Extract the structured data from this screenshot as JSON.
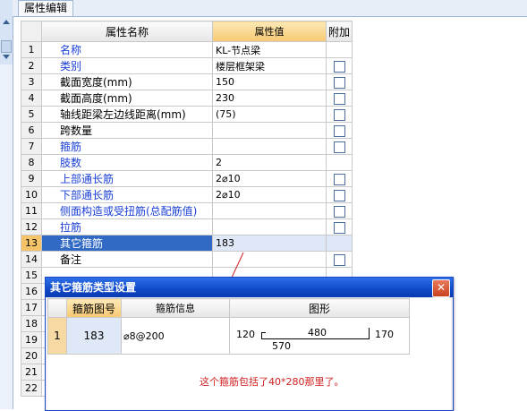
{
  "tab": {
    "label": "属性编辑"
  },
  "grid": {
    "headers": {
      "name": "属性名称",
      "value": "属性值",
      "add": "附加"
    },
    "rows": [
      {
        "num": "1",
        "name": "名称",
        "value": "KL-节点梁",
        "blue": true,
        "cb": false
      },
      {
        "num": "2",
        "name": "类别",
        "value": "楼层框架梁",
        "blue": true,
        "cb": true
      },
      {
        "num": "3",
        "name": "截面宽度(mm)",
        "value": "150",
        "blue": false,
        "cb": true
      },
      {
        "num": "4",
        "name": "截面高度(mm)",
        "value": "230",
        "blue": false,
        "cb": true
      },
      {
        "num": "5",
        "name": "轴线距梁左边线距离(mm)",
        "value": "(75)",
        "blue": false,
        "cb": true
      },
      {
        "num": "6",
        "name": "跨数量",
        "value": "",
        "blue": false,
        "cb": true
      },
      {
        "num": "7",
        "name": "箍筋",
        "value": "",
        "blue": true,
        "cb": true
      },
      {
        "num": "8",
        "name": "肢数",
        "value": "2",
        "blue": true,
        "cb": false
      },
      {
        "num": "9",
        "name": "上部通长筋",
        "value": "2⌀10",
        "blue": true,
        "cb": true
      },
      {
        "num": "10",
        "name": "下部通长筋",
        "value": "2⌀10",
        "blue": true,
        "cb": true
      },
      {
        "num": "11",
        "name": "侧面构造或受扭筋(总配筋值)",
        "value": "",
        "blue": true,
        "cb": true
      },
      {
        "num": "12",
        "name": "拉筋",
        "value": "",
        "blue": true,
        "cb": true
      },
      {
        "num": "13",
        "name": "其它箍筋",
        "value": "183",
        "blue": false,
        "cb": false,
        "selected": true
      },
      {
        "num": "14",
        "name": "备注",
        "value": "",
        "blue": false,
        "cb": true
      },
      {
        "num": "15",
        "name": "",
        "value": "",
        "blue": false,
        "cb": false
      },
      {
        "num": "16",
        "name": "",
        "value": "",
        "blue": false,
        "cb": false
      },
      {
        "num": "17",
        "name": "",
        "value": "",
        "blue": false,
        "cb": false
      },
      {
        "num": "18",
        "name": "",
        "value": "",
        "blue": false,
        "cb": false
      },
      {
        "num": "19",
        "name": "",
        "value": "",
        "blue": false,
        "cb": false
      },
      {
        "num": "20",
        "name": "",
        "value": "",
        "blue": false,
        "cb": false
      },
      {
        "num": "21",
        "name": "",
        "value": "",
        "blue": false,
        "cb": false
      },
      {
        "num": "22",
        "name": "",
        "value": "",
        "blue": false,
        "cb": false
      }
    ]
  },
  "dialog": {
    "title": "其它箍筋类型设置",
    "close": "✕",
    "headers": {
      "code": "箍筋图号",
      "info": "箍筋信息",
      "shape": "图形"
    },
    "row": {
      "num": "1",
      "code": "183",
      "info": "⌀8@200"
    },
    "shape": {
      "left": "120",
      "top": "480",
      "right": "170",
      "bottom": "570"
    },
    "note": "这个箍筋包括了40*280那里了。"
  },
  "colors": {
    "selected": "#316ac5",
    "accent": "#f6c873",
    "note": "#d12020",
    "title": "#1049c8"
  }
}
